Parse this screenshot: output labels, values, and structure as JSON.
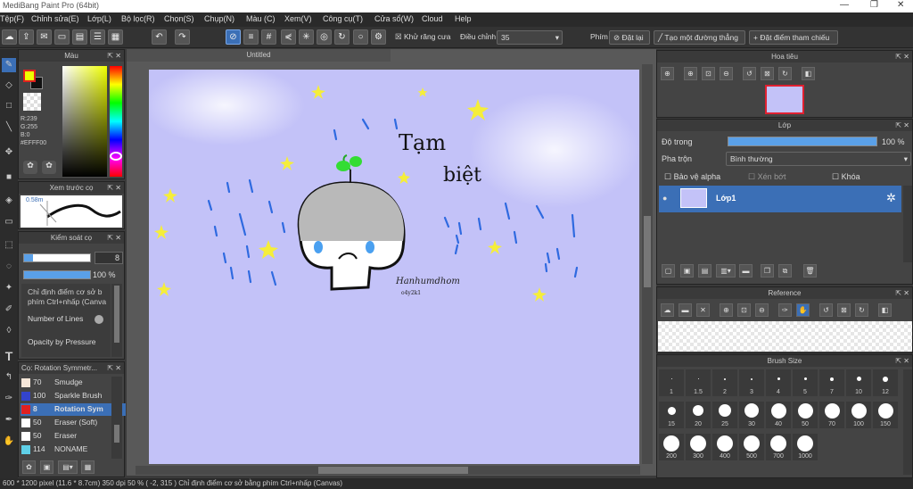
{
  "window": {
    "title": "MediBang Paint Pro (64bit)"
  },
  "menu": [
    "Tệp(F)",
    "Chỉnh sửa(E)",
    "Lớp(L)",
    "Bộ lọc(R)",
    "Chọn(S)",
    "Chụp(N)",
    "Màu (C)",
    "Xem(V)",
    "Công cụ(T)",
    "Cửa sổ(W)",
    "Cloud",
    "Help"
  ],
  "toolbar": {
    "antialias": "Khử răng cưa",
    "correction_label": "Điều chỉnh",
    "correction_value": "35",
    "snap_label": "Phím",
    "snap_off": "Đặt lại",
    "snap_line": "Tạo một đường thẳng",
    "snap_point": "Đặt điểm tham chiếu"
  },
  "color_panel": {
    "title": "Màu",
    "r": "R:239",
    "g": "G:255",
    "b": "B:0",
    "hex": "#EFFF00",
    "fg": "#efff00",
    "bg": "#111111"
  },
  "preview_panel": {
    "title": "Xem trước cọ",
    "size": "0.58m"
  },
  "brush_control": {
    "title": "Kiểm soát cọ",
    "size_value": "8",
    "opacity_value": "100 %",
    "desc": "Chỉ định điểm cơ sở b phím Ctrl+nhấp (Canva",
    "number_of_lines": "Number of Lines",
    "opacity_by_pressure": "Opacity by Pressure"
  },
  "brush_list": {
    "title": "Cọ: Rotation Symmetr...",
    "items": [
      {
        "size": "70",
        "name": "Smudge",
        "color": "#f5e6d8"
      },
      {
        "size": "100",
        "name": "Sparkle Brush",
        "color": "#3344cc"
      },
      {
        "size": "8",
        "name": "Rotation Sym",
        "color": "#e02020",
        "selected": true
      },
      {
        "size": "50",
        "name": "Eraser (Soft)",
        "color": "#ffffff"
      },
      {
        "size": "50",
        "name": "Eraser",
        "color": "#ffffff"
      },
      {
        "size": "114",
        "name": "NONAME",
        "color": "#5fd0e8"
      }
    ]
  },
  "canvas": {
    "tab": "Untitled",
    "text1": "Tạm",
    "text2": "biệt",
    "signature": "Hanhumdhom",
    "signature2": "o4y2k1",
    "bg": "#c3c2f8"
  },
  "navigator": {
    "title": "Hoa tiêu"
  },
  "layer_panel": {
    "title": "Lớp",
    "opacity_label": "Độ trong",
    "opacity_value": "100 %",
    "blend_label": "Pha trộn",
    "blend_value": "Bình thường",
    "protect_alpha": "Bảo vệ alpha",
    "clip": "Xén bớt",
    "lock": "Khóa",
    "layer_name": "Lớp1"
  },
  "reference": {
    "title": "Reference"
  },
  "brush_size": {
    "title": "Brush Size",
    "sizes": [
      "1",
      "1.5",
      "2",
      "3",
      "4",
      "5",
      "7",
      "10",
      "12",
      "15",
      "20",
      "25",
      "30",
      "40",
      "50",
      "70",
      "100",
      "150",
      "200",
      "300",
      "400",
      "500",
      "700",
      "1000"
    ]
  },
  "status": "600 * 1200 pixel  (11.6 * 8.7cm)  350 dpi  50 %  ( -2, 315 )  Chỉ định điểm cơ sở bằng phím Ctrl+nhấp (Canvas)"
}
